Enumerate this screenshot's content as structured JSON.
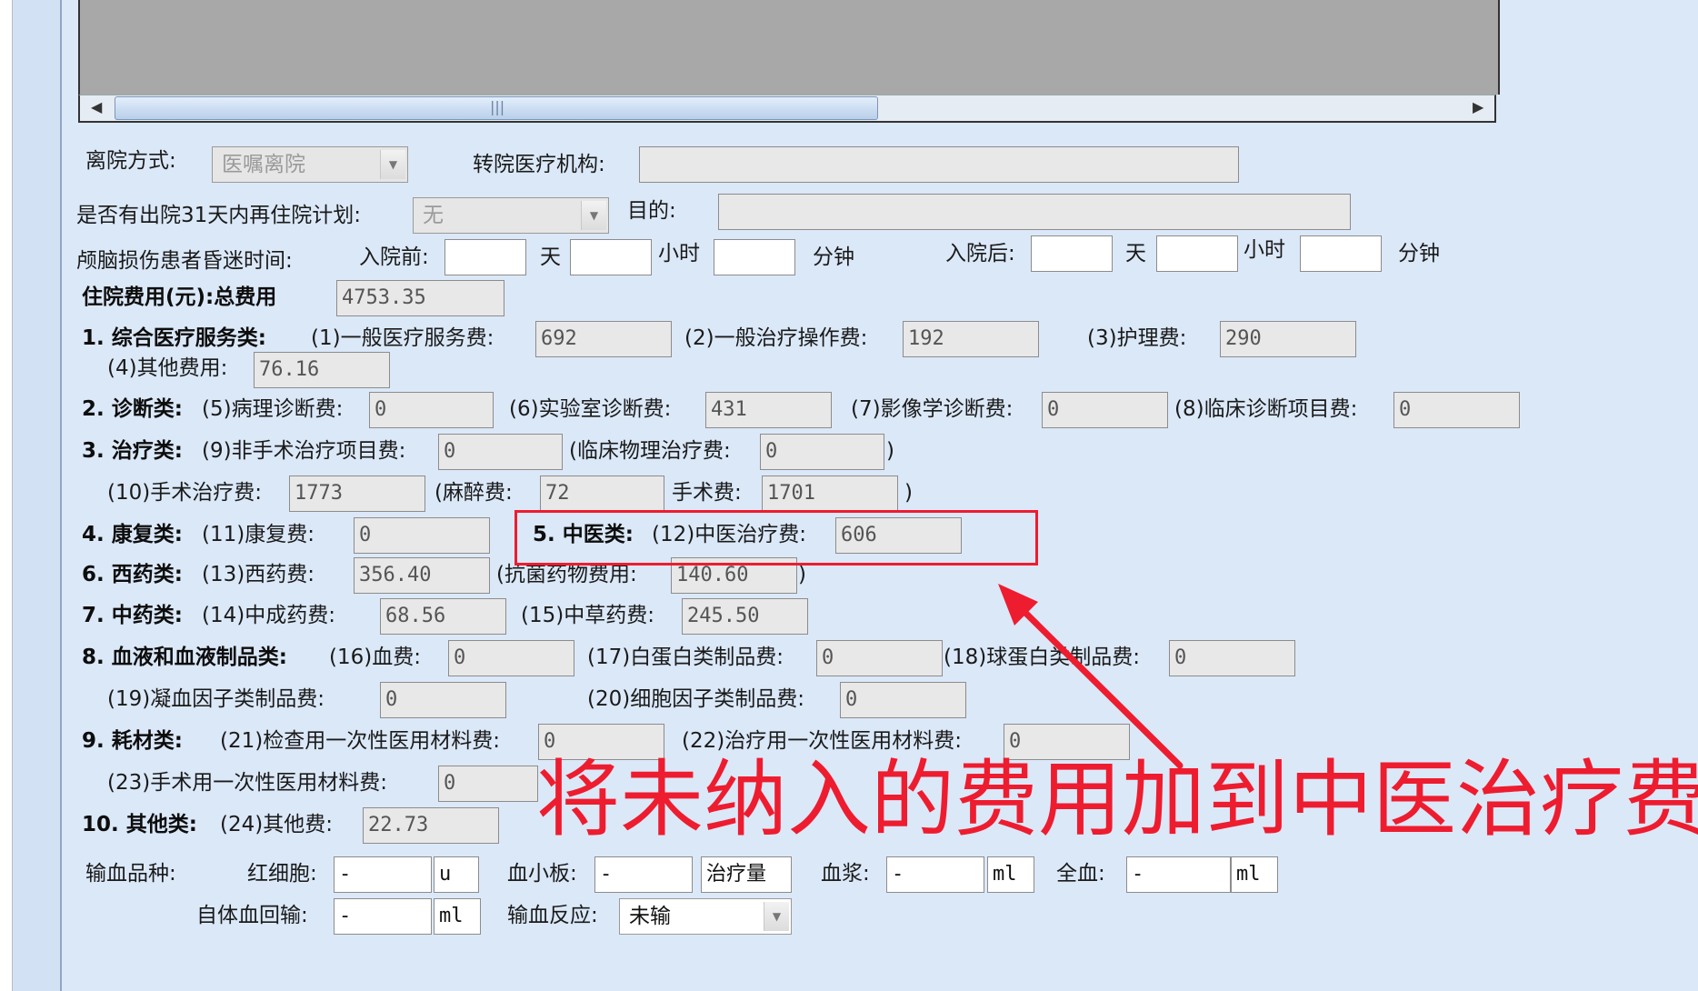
{
  "leave": {
    "label": "离院方式:",
    "value": "医嘱离院",
    "transfer_label": "转院医疗机构:",
    "transfer_value": ""
  },
  "readmit": {
    "label": "是否有出院31天内再住院计划:",
    "value": "无",
    "purpose_label": "目的:",
    "purpose_value": ""
  },
  "coma": {
    "label": "颅脑损伤患者昏迷时间:",
    "before_label": "入院前:",
    "after_label": "入院后:",
    "unit_day": "天",
    "unit_hour": "小时",
    "unit_min": "分钟",
    "before_day": "",
    "before_hour": "",
    "before_min": "",
    "after_day": "",
    "after_hour": "",
    "after_min": ""
  },
  "cost": {
    "title": "住院费用(元):总费用",
    "total": "4753.35",
    "c1_label": "1. 综合医疗服务类:",
    "f1_label": "(1)一般医疗服务费:",
    "f1": "692",
    "f2_label": "(2)一般治疗操作费:",
    "f2": "192",
    "f3_label": "(3)护理费:",
    "f3": "290",
    "f4_label": "(4)其他费用:",
    "f4": "76.16",
    "c2_label": "2. 诊断类:",
    "f5_label": "(5)病理诊断费:",
    "f5": "0",
    "f6_label": "(6)实验室诊断费:",
    "f6": "431",
    "f7_label": "(7)影像学诊断费:",
    "f7": "0",
    "f8_label": "(8)临床诊断项目费:",
    "f8": "0",
    "c3_label": "3. 治疗类:",
    "f9_label": "(9)非手术治疗项目费:",
    "f9": "0",
    "f9a_label": "(临床物理治疗费:",
    "f9a": "0",
    "close_paren": ")",
    "f10_label": "(10)手术治疗费:",
    "f10": "1773",
    "f10a_label": "(麻醉费:",
    "f10a": "72",
    "f10b_label": "手术费:",
    "f10b": "1701",
    "c4_label": "4. 康复类:",
    "f11_label": "(11)康复费:",
    "f11": "0",
    "c5_label": "5. 中医类:",
    "f12_label": "(12)中医治疗费:",
    "f12": "606",
    "c6_label": "6. 西药类:",
    "f13_label": "(13)西药费:",
    "f13": "356.40",
    "f13a_label": "(抗菌药物费用:",
    "f13a": "140.60",
    "c7_label": "7. 中药类:",
    "f14_label": "(14)中成药费:",
    "f14": "68.56",
    "f15_label": "(15)中草药费:",
    "f15": "245.50",
    "c8_label": "8. 血液和血液制品类:",
    "f16_label": "(16)血费:",
    "f16": "0",
    "f17_label": "(17)白蛋白类制品费:",
    "f17": "0",
    "f18_label": "(18)球蛋白类制品费:",
    "f18": "0",
    "f19_label": "(19)凝血因子类制品费:",
    "f19": "0",
    "f20_label": "(20)细胞因子类制品费:",
    "f20": "0",
    "c9_label": "9. 耗材类:",
    "f21_label": "(21)检查用一次性医用材料费:",
    "f21": "0",
    "f22_label": "(22)治疗用一次性医用材料费:",
    "f22": "0",
    "f23_label": "(23)手术用一次性医用材料费:",
    "f23": "0",
    "c10_label": "10. 其他类:",
    "f24_label": "(24)其他费:",
    "f24": "22.73"
  },
  "transfusion": {
    "label": "输血品种:",
    "rbc_label": "红细胞:",
    "rbc": "-",
    "rbc_unit": "u",
    "plt_label": "血小板:",
    "plt": "-",
    "plt_unit": "治疗量",
    "plasma_label": "血浆:",
    "plasma": "-",
    "plasma_unit": "ml",
    "whole_label": "全血:",
    "whole": "-",
    "whole_unit": "ml",
    "auto_label": "自体血回输:",
    "auto": "-",
    "auto_unit": "ml",
    "reaction_label": "输血反应:",
    "reaction": "未输"
  },
  "annotation": {
    "text": "将未纳入的费用加到中医治疗费里",
    "color": "#ee1c2f"
  }
}
